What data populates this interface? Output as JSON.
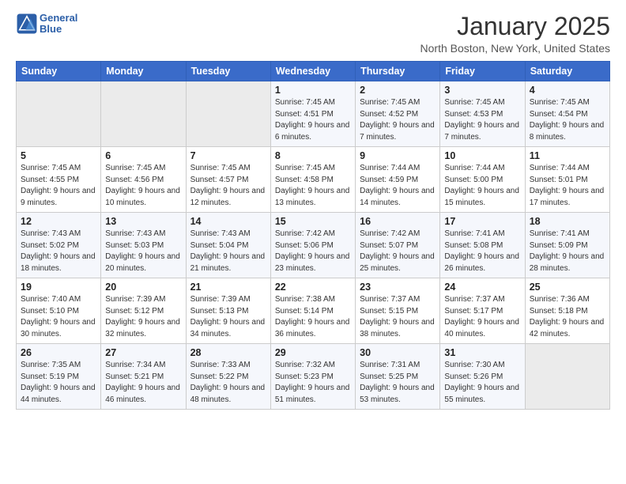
{
  "header": {
    "logo_line1": "General",
    "logo_line2": "Blue",
    "month_title": "January 2025",
    "location": "North Boston, New York, United States"
  },
  "days_of_week": [
    "Sunday",
    "Monday",
    "Tuesday",
    "Wednesday",
    "Thursday",
    "Friday",
    "Saturday"
  ],
  "weeks": [
    [
      {
        "day": "",
        "info": ""
      },
      {
        "day": "",
        "info": ""
      },
      {
        "day": "",
        "info": ""
      },
      {
        "day": "1",
        "info": "Sunrise: 7:45 AM\nSunset: 4:51 PM\nDaylight: 9 hours and 6 minutes."
      },
      {
        "day": "2",
        "info": "Sunrise: 7:45 AM\nSunset: 4:52 PM\nDaylight: 9 hours and 7 minutes."
      },
      {
        "day": "3",
        "info": "Sunrise: 7:45 AM\nSunset: 4:53 PM\nDaylight: 9 hours and 7 minutes."
      },
      {
        "day": "4",
        "info": "Sunrise: 7:45 AM\nSunset: 4:54 PM\nDaylight: 9 hours and 8 minutes."
      }
    ],
    [
      {
        "day": "5",
        "info": "Sunrise: 7:45 AM\nSunset: 4:55 PM\nDaylight: 9 hours and 9 minutes."
      },
      {
        "day": "6",
        "info": "Sunrise: 7:45 AM\nSunset: 4:56 PM\nDaylight: 9 hours and 10 minutes."
      },
      {
        "day": "7",
        "info": "Sunrise: 7:45 AM\nSunset: 4:57 PM\nDaylight: 9 hours and 12 minutes."
      },
      {
        "day": "8",
        "info": "Sunrise: 7:45 AM\nSunset: 4:58 PM\nDaylight: 9 hours and 13 minutes."
      },
      {
        "day": "9",
        "info": "Sunrise: 7:44 AM\nSunset: 4:59 PM\nDaylight: 9 hours and 14 minutes."
      },
      {
        "day": "10",
        "info": "Sunrise: 7:44 AM\nSunset: 5:00 PM\nDaylight: 9 hours and 15 minutes."
      },
      {
        "day": "11",
        "info": "Sunrise: 7:44 AM\nSunset: 5:01 PM\nDaylight: 9 hours and 17 minutes."
      }
    ],
    [
      {
        "day": "12",
        "info": "Sunrise: 7:43 AM\nSunset: 5:02 PM\nDaylight: 9 hours and 18 minutes."
      },
      {
        "day": "13",
        "info": "Sunrise: 7:43 AM\nSunset: 5:03 PM\nDaylight: 9 hours and 20 minutes."
      },
      {
        "day": "14",
        "info": "Sunrise: 7:43 AM\nSunset: 5:04 PM\nDaylight: 9 hours and 21 minutes."
      },
      {
        "day": "15",
        "info": "Sunrise: 7:42 AM\nSunset: 5:06 PM\nDaylight: 9 hours and 23 minutes."
      },
      {
        "day": "16",
        "info": "Sunrise: 7:42 AM\nSunset: 5:07 PM\nDaylight: 9 hours and 25 minutes."
      },
      {
        "day": "17",
        "info": "Sunrise: 7:41 AM\nSunset: 5:08 PM\nDaylight: 9 hours and 26 minutes."
      },
      {
        "day": "18",
        "info": "Sunrise: 7:41 AM\nSunset: 5:09 PM\nDaylight: 9 hours and 28 minutes."
      }
    ],
    [
      {
        "day": "19",
        "info": "Sunrise: 7:40 AM\nSunset: 5:10 PM\nDaylight: 9 hours and 30 minutes."
      },
      {
        "day": "20",
        "info": "Sunrise: 7:39 AM\nSunset: 5:12 PM\nDaylight: 9 hours and 32 minutes."
      },
      {
        "day": "21",
        "info": "Sunrise: 7:39 AM\nSunset: 5:13 PM\nDaylight: 9 hours and 34 minutes."
      },
      {
        "day": "22",
        "info": "Sunrise: 7:38 AM\nSunset: 5:14 PM\nDaylight: 9 hours and 36 minutes."
      },
      {
        "day": "23",
        "info": "Sunrise: 7:37 AM\nSunset: 5:15 PM\nDaylight: 9 hours and 38 minutes."
      },
      {
        "day": "24",
        "info": "Sunrise: 7:37 AM\nSunset: 5:17 PM\nDaylight: 9 hours and 40 minutes."
      },
      {
        "day": "25",
        "info": "Sunrise: 7:36 AM\nSunset: 5:18 PM\nDaylight: 9 hours and 42 minutes."
      }
    ],
    [
      {
        "day": "26",
        "info": "Sunrise: 7:35 AM\nSunset: 5:19 PM\nDaylight: 9 hours and 44 minutes."
      },
      {
        "day": "27",
        "info": "Sunrise: 7:34 AM\nSunset: 5:21 PM\nDaylight: 9 hours and 46 minutes."
      },
      {
        "day": "28",
        "info": "Sunrise: 7:33 AM\nSunset: 5:22 PM\nDaylight: 9 hours and 48 minutes."
      },
      {
        "day": "29",
        "info": "Sunrise: 7:32 AM\nSunset: 5:23 PM\nDaylight: 9 hours and 51 minutes."
      },
      {
        "day": "30",
        "info": "Sunrise: 7:31 AM\nSunset: 5:25 PM\nDaylight: 9 hours and 53 minutes."
      },
      {
        "day": "31",
        "info": "Sunrise: 7:30 AM\nSunset: 5:26 PM\nDaylight: 9 hours and 55 minutes."
      },
      {
        "day": "",
        "info": ""
      }
    ]
  ]
}
